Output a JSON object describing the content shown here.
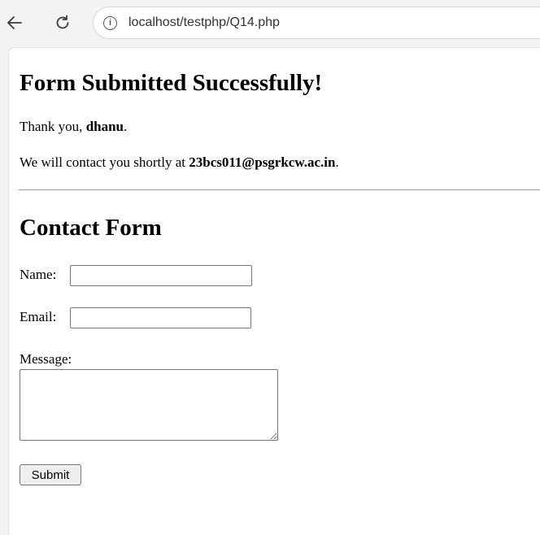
{
  "browser": {
    "url": "localhost/testphp/Q14.php",
    "back_icon": "back-arrow-icon",
    "reload_icon": "reload-icon",
    "info_icon": "info-icon"
  },
  "success": {
    "heading": "Form Submitted Successfully!",
    "thanks_prefix": "Thank you, ",
    "name": "dhanu",
    "thanks_suffix": ".",
    "contact_prefix": "We will contact you shortly at ",
    "email": "23bcs011@psgrkcw.ac.in",
    "contact_suffix": "."
  },
  "form": {
    "heading": "Contact Form",
    "name_label": "Name:",
    "name_value": "",
    "email_label": "Email:",
    "email_value": "",
    "message_label": "Message:",
    "message_value": "",
    "submit_label": "Submit"
  }
}
